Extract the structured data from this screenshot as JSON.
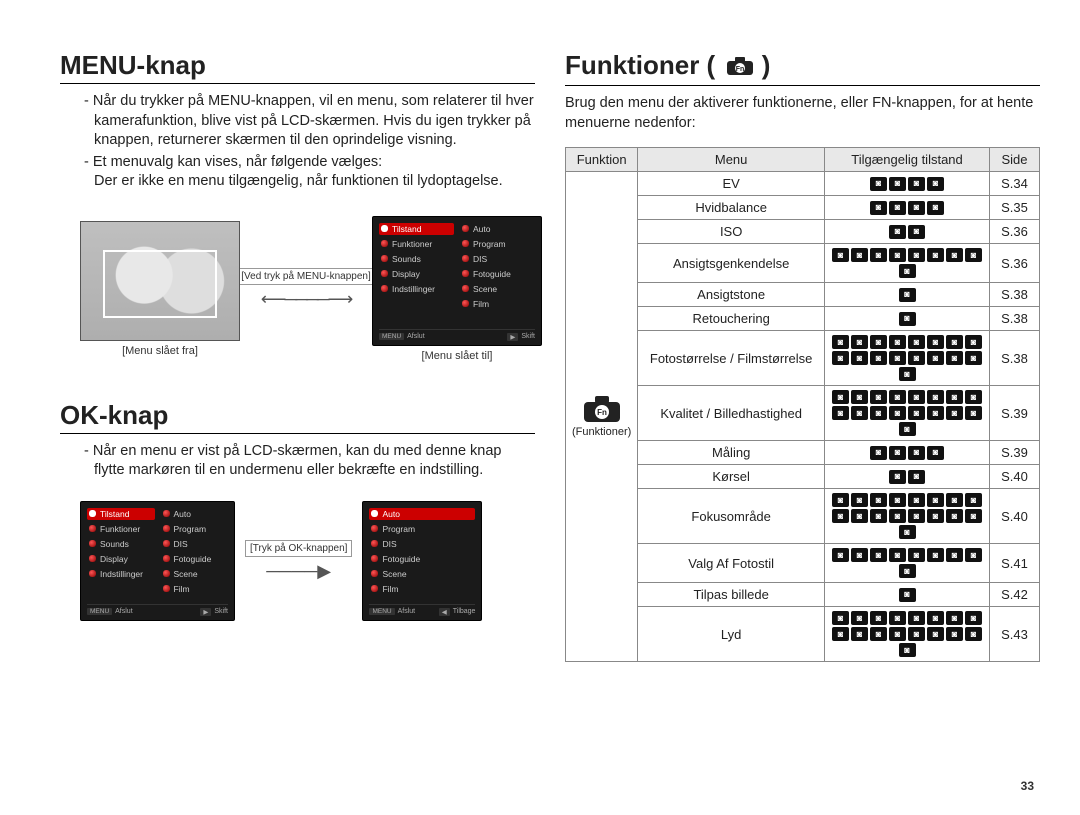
{
  "page_number": "33",
  "left": {
    "heading_menu": "MENU-knap",
    "para_menu_1": "- Når du trykker på MENU-knappen, vil en menu, som relaterer til hver kamerafunktion, blive vist på LCD-skærmen. Hvis du igen trykker på knappen, returnerer skærmen til den oprindelige visning.",
    "para_menu_2": "- Et menuvalg kan vises, når følgende vælges:",
    "para_menu_3": "Der er ikke en menu tilgængelig, når funktionen til lydoptagelse.",
    "caption_off": "[Menu slået fra]",
    "arrow_label": "[Ved tryk på MENU-knappen]",
    "caption_on": "[Menu slået til]",
    "menu_left_items": [
      "Tilstand",
      "Funktioner",
      "Sounds",
      "Display",
      "Indstillinger"
    ],
    "menu_right_items": [
      "Auto",
      "Program",
      "DIS",
      "Fotoguide",
      "Scene",
      "Film"
    ],
    "menu_bottom_left": "Afslut",
    "menu_bottom_left_btn": "MENU",
    "menu_bottom_right": "Skift",
    "heading_ok": "OK-knap",
    "para_ok_1": "- Når en menu er vist på LCD-skærmen, kan du med denne knap flytte markøren til en undermenu eller bekræfte en indstilling.",
    "ok_arrow_label": "[Tryk på OK-knappen]",
    "ok_menu_bottom_right": "Tilbage"
  },
  "right": {
    "heading": "Funktioner (",
    "heading_close": ")",
    "intro": "Brug den menu der aktiverer funktionerne, eller FN-knappen, for at hente menuerne nedenfor:",
    "th_funktion": "Funktion",
    "th_menu": "Menu",
    "th_tilstand": "Tilgængelig tilstand",
    "th_side": "Side",
    "fn_label": "Funktioner",
    "rows": [
      {
        "menu": "EV",
        "modes": 4,
        "side": "S.34"
      },
      {
        "menu": "Hvidbalance",
        "modes": 4,
        "side": "S.35"
      },
      {
        "menu": "ISO",
        "modes": 2,
        "side": "S.36"
      },
      {
        "menu": "Ansigtsgenkendelse",
        "modes": 9,
        "side": "S.36"
      },
      {
        "menu": "Ansigtstone",
        "modes": 1,
        "side": "S.38"
      },
      {
        "menu": "Retouchering",
        "modes": 1,
        "side": "S.38"
      },
      {
        "menu": "Fotostørrelse / Filmstørrelse",
        "modes": 17,
        "side": "S.38"
      },
      {
        "menu": "Kvalitet / Billedhastighed",
        "modes": 17,
        "side": "S.39"
      },
      {
        "menu": "Måling",
        "modes": 4,
        "side": "S.39"
      },
      {
        "menu": "Kørsel",
        "modes": 2,
        "side": "S.40"
      },
      {
        "menu": "Fokusområde",
        "modes": 17,
        "side": "S.40"
      },
      {
        "menu": "Valg Af Fotostil",
        "modes": 9,
        "side": "S.41"
      },
      {
        "menu": "Tilpas billede",
        "modes": 1,
        "side": "S.42"
      },
      {
        "menu": "Lyd",
        "modes": 17,
        "side": "S.43"
      }
    ]
  }
}
